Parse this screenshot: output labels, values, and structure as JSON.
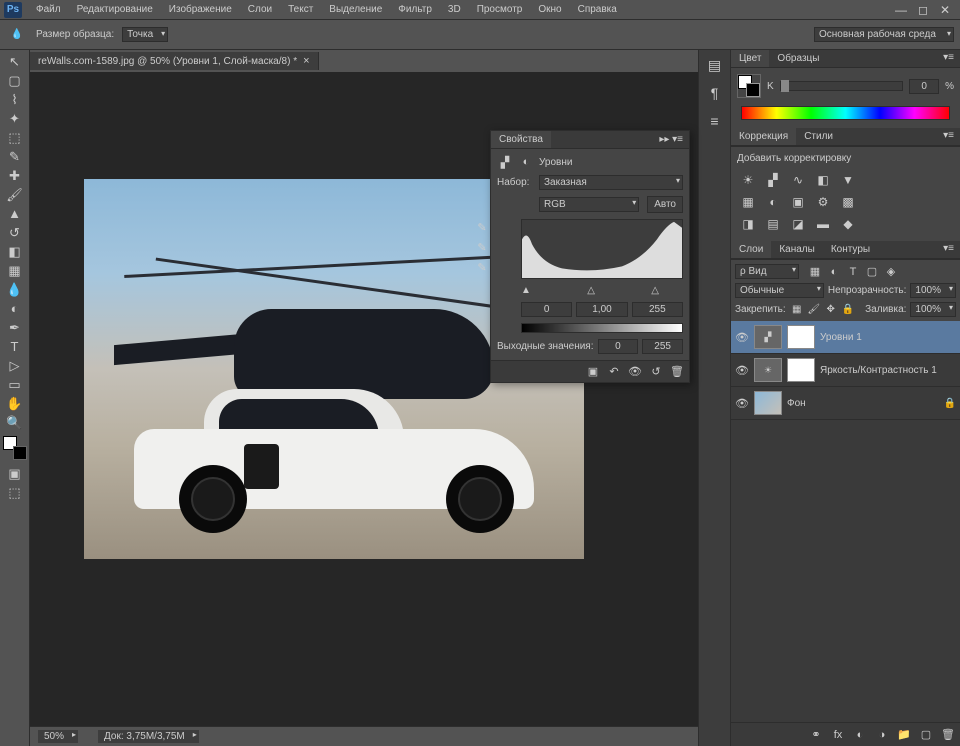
{
  "menubar": {
    "items": [
      "Файл",
      "Редактирование",
      "Изображение",
      "Слои",
      "Текст",
      "Выделение",
      "Фильтр",
      "3D",
      "Просмотр",
      "Окно",
      "Справка"
    ]
  },
  "optbar": {
    "sample_label": "Размер образца:",
    "sample_value": "Точка",
    "workspace": "Основная рабочая среда"
  },
  "document": {
    "tab_title": "reWalls.com-1589.jpg @ 50% (Уровни 1, Слой-маска/8) *"
  },
  "statusbar": {
    "zoom": "50%",
    "doc_info": "Док: 3,75M/3,75M"
  },
  "panels": {
    "color": {
      "tabs": [
        "Цвет",
        "Образцы"
      ],
      "k_label": "K",
      "k_value": "0",
      "k_pct": "%"
    },
    "adjustments": {
      "tabs": [
        "Коррекция",
        "Стили"
      ],
      "title": "Добавить корректировку"
    },
    "layers": {
      "tabs": [
        "Слои",
        "Каналы",
        "Контуры"
      ],
      "filter_label": "ρ Вид",
      "blend_mode": "Обычные",
      "opacity_label": "Непрозрачность:",
      "opacity_value": "100%",
      "lock_label": "Закрепить:",
      "fill_label": "Заливка:",
      "fill_value": "100%",
      "items": [
        {
          "name": "Уровни 1",
          "visible": true,
          "type": "levels"
        },
        {
          "name": "Яркость/Контрастность 1",
          "visible": true,
          "type": "brightness"
        },
        {
          "name": "Фон",
          "visible": true,
          "type": "image",
          "locked": true
        }
      ]
    }
  },
  "properties": {
    "tab": "Свойства",
    "title": "Уровни",
    "preset_label": "Набор:",
    "preset_value": "Заказная",
    "channel": "RGB",
    "auto": "Авто",
    "levels": {
      "shadow": "0",
      "mid": "1,00",
      "highlight": "255"
    },
    "output_label": "Выходные значения:",
    "output": {
      "low": "0",
      "high": "255"
    }
  }
}
